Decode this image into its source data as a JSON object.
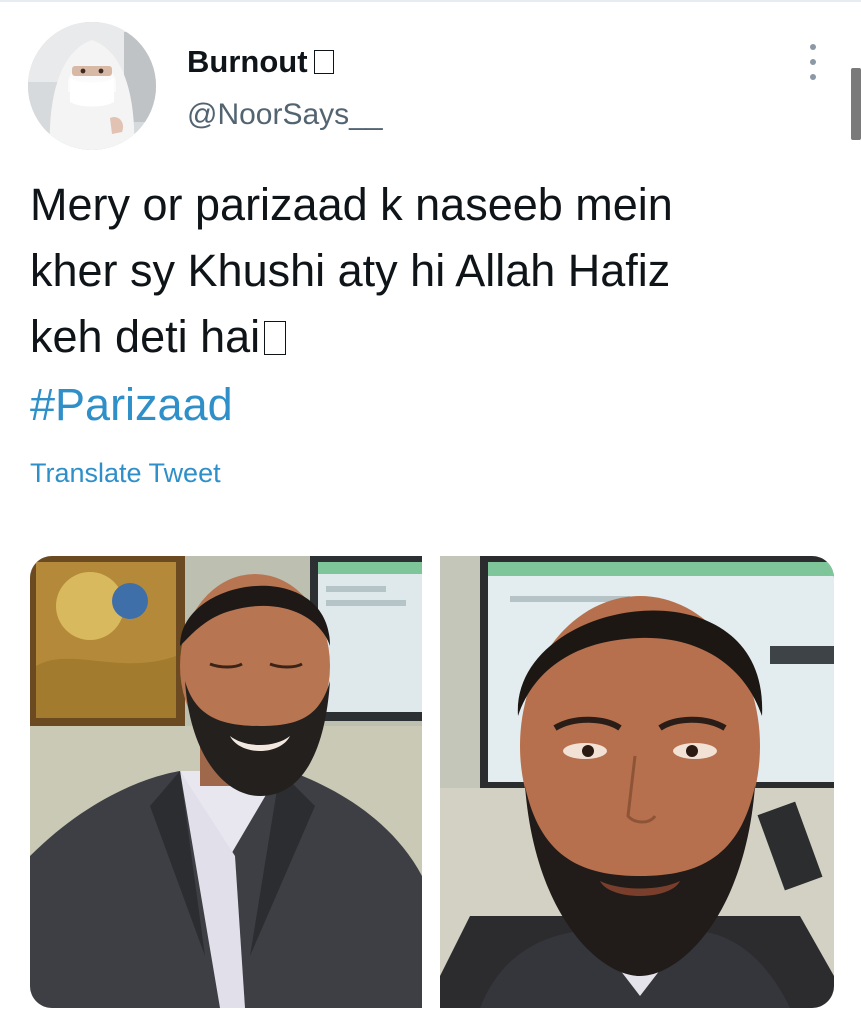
{
  "tweet": {
    "author": {
      "display_name": "Burnout",
      "handle": "@NoorSays__"
    },
    "text_lines": [
      "Mery or parizaad k naseeb mein",
      "kher sy Khushi aty hi Allah Hafiz",
      "keh deti hai"
    ],
    "hashtag": "#Parizaad",
    "translate_label": "Translate Tweet",
    "media_count": 2
  },
  "icons": {
    "more": "more-vertical-icon",
    "emoji": "emoji-glyph"
  },
  "colors": {
    "link": "#2f8fc9",
    "text": "#0f1419",
    "secondary": "#536471"
  }
}
